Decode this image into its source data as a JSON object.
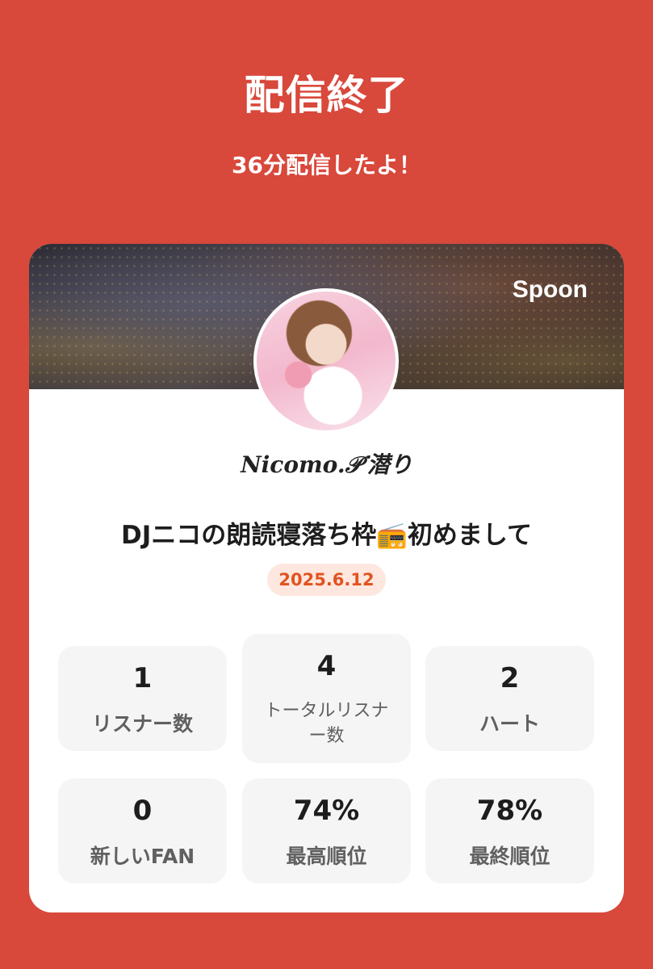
{
  "header": {
    "title": "配信終了",
    "subtitle": "36分配信したよ！"
  },
  "card": {
    "brand": "Spoon",
    "username": "Nicomo.𝒫ᐝ潜り",
    "live_title": "DJニコの朗読寝落ち枠📻初めまして",
    "date": "2025.6.12"
  },
  "stats": [
    {
      "value": "1",
      "label": "リスナー数"
    },
    {
      "value": "4",
      "label": "トータルリスナー数"
    },
    {
      "value": "2",
      "label": "ハート"
    },
    {
      "value": "0",
      "label": "新しいFAN"
    },
    {
      "value": "74%",
      "label": "最高順位"
    },
    {
      "value": "78%",
      "label": "最終順位"
    }
  ],
  "colors": {
    "background": "#d8483b",
    "card": "#ffffff",
    "date_text": "#e2531f",
    "date_bg": "#fde7df",
    "stat_bg": "#f5f5f5"
  }
}
